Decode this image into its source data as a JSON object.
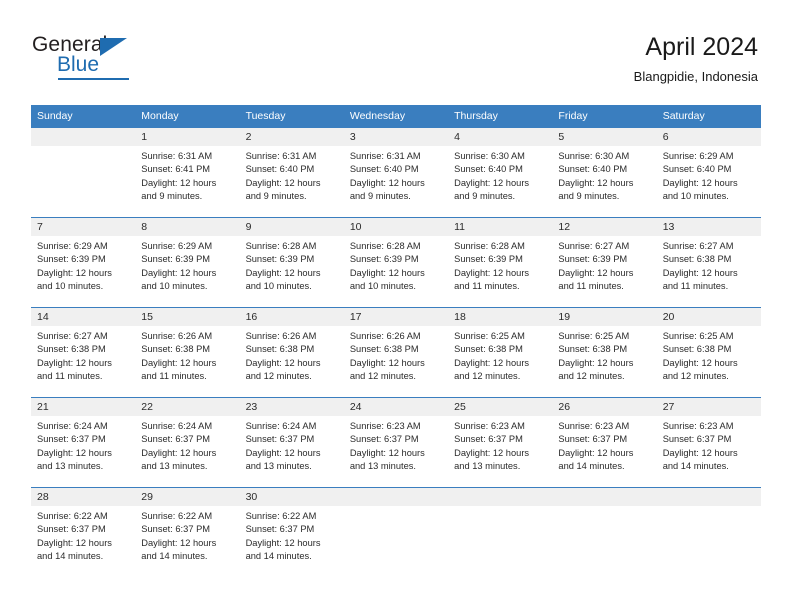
{
  "brand": {
    "name_top": "General",
    "name_bottom": "Blue",
    "triangle_color": "#1f6cb0",
    "accent_color": "#3a7ebf"
  },
  "header": {
    "title": "April 2024",
    "subtitle": "Blangpidie, Indonesia"
  },
  "weekdays": [
    "Sunday",
    "Monday",
    "Tuesday",
    "Wednesday",
    "Thursday",
    "Friday",
    "Saturday"
  ],
  "weeks": [
    [
      {
        "day": ""
      },
      {
        "day": "1",
        "sunrise": "Sunrise: 6:31 AM",
        "sunset": "Sunset: 6:41 PM",
        "daylight_line1": "Daylight: 12 hours",
        "daylight_line2": "and 9 minutes."
      },
      {
        "day": "2",
        "sunrise": "Sunrise: 6:31 AM",
        "sunset": "Sunset: 6:40 PM",
        "daylight_line1": "Daylight: 12 hours",
        "daylight_line2": "and 9 minutes."
      },
      {
        "day": "3",
        "sunrise": "Sunrise: 6:31 AM",
        "sunset": "Sunset: 6:40 PM",
        "daylight_line1": "Daylight: 12 hours",
        "daylight_line2": "and 9 minutes."
      },
      {
        "day": "4",
        "sunrise": "Sunrise: 6:30 AM",
        "sunset": "Sunset: 6:40 PM",
        "daylight_line1": "Daylight: 12 hours",
        "daylight_line2": "and 9 minutes."
      },
      {
        "day": "5",
        "sunrise": "Sunrise: 6:30 AM",
        "sunset": "Sunset: 6:40 PM",
        "daylight_line1": "Daylight: 12 hours",
        "daylight_line2": "and 9 minutes."
      },
      {
        "day": "6",
        "sunrise": "Sunrise: 6:29 AM",
        "sunset": "Sunset: 6:40 PM",
        "daylight_line1": "Daylight: 12 hours",
        "daylight_line2": "and 10 minutes."
      }
    ],
    [
      {
        "day": "7",
        "sunrise": "Sunrise: 6:29 AM",
        "sunset": "Sunset: 6:39 PM",
        "daylight_line1": "Daylight: 12 hours",
        "daylight_line2": "and 10 minutes."
      },
      {
        "day": "8",
        "sunrise": "Sunrise: 6:29 AM",
        "sunset": "Sunset: 6:39 PM",
        "daylight_line1": "Daylight: 12 hours",
        "daylight_line2": "and 10 minutes."
      },
      {
        "day": "9",
        "sunrise": "Sunrise: 6:28 AM",
        "sunset": "Sunset: 6:39 PM",
        "daylight_line1": "Daylight: 12 hours",
        "daylight_line2": "and 10 minutes."
      },
      {
        "day": "10",
        "sunrise": "Sunrise: 6:28 AM",
        "sunset": "Sunset: 6:39 PM",
        "daylight_line1": "Daylight: 12 hours",
        "daylight_line2": "and 10 minutes."
      },
      {
        "day": "11",
        "sunrise": "Sunrise: 6:28 AM",
        "sunset": "Sunset: 6:39 PM",
        "daylight_line1": "Daylight: 12 hours",
        "daylight_line2": "and 11 minutes."
      },
      {
        "day": "12",
        "sunrise": "Sunrise: 6:27 AM",
        "sunset": "Sunset: 6:39 PM",
        "daylight_line1": "Daylight: 12 hours",
        "daylight_line2": "and 11 minutes."
      },
      {
        "day": "13",
        "sunrise": "Sunrise: 6:27 AM",
        "sunset": "Sunset: 6:38 PM",
        "daylight_line1": "Daylight: 12 hours",
        "daylight_line2": "and 11 minutes."
      }
    ],
    [
      {
        "day": "14",
        "sunrise": "Sunrise: 6:27 AM",
        "sunset": "Sunset: 6:38 PM",
        "daylight_line1": "Daylight: 12 hours",
        "daylight_line2": "and 11 minutes."
      },
      {
        "day": "15",
        "sunrise": "Sunrise: 6:26 AM",
        "sunset": "Sunset: 6:38 PM",
        "daylight_line1": "Daylight: 12 hours",
        "daylight_line2": "and 11 minutes."
      },
      {
        "day": "16",
        "sunrise": "Sunrise: 6:26 AM",
        "sunset": "Sunset: 6:38 PM",
        "daylight_line1": "Daylight: 12 hours",
        "daylight_line2": "and 12 minutes."
      },
      {
        "day": "17",
        "sunrise": "Sunrise: 6:26 AM",
        "sunset": "Sunset: 6:38 PM",
        "daylight_line1": "Daylight: 12 hours",
        "daylight_line2": "and 12 minutes."
      },
      {
        "day": "18",
        "sunrise": "Sunrise: 6:25 AM",
        "sunset": "Sunset: 6:38 PM",
        "daylight_line1": "Daylight: 12 hours",
        "daylight_line2": "and 12 minutes."
      },
      {
        "day": "19",
        "sunrise": "Sunrise: 6:25 AM",
        "sunset": "Sunset: 6:38 PM",
        "daylight_line1": "Daylight: 12 hours",
        "daylight_line2": "and 12 minutes."
      },
      {
        "day": "20",
        "sunrise": "Sunrise: 6:25 AM",
        "sunset": "Sunset: 6:38 PM",
        "daylight_line1": "Daylight: 12 hours",
        "daylight_line2": "and 12 minutes."
      }
    ],
    [
      {
        "day": "21",
        "sunrise": "Sunrise: 6:24 AM",
        "sunset": "Sunset: 6:37 PM",
        "daylight_line1": "Daylight: 12 hours",
        "daylight_line2": "and 13 minutes."
      },
      {
        "day": "22",
        "sunrise": "Sunrise: 6:24 AM",
        "sunset": "Sunset: 6:37 PM",
        "daylight_line1": "Daylight: 12 hours",
        "daylight_line2": "and 13 minutes."
      },
      {
        "day": "23",
        "sunrise": "Sunrise: 6:24 AM",
        "sunset": "Sunset: 6:37 PM",
        "daylight_line1": "Daylight: 12 hours",
        "daylight_line2": "and 13 minutes."
      },
      {
        "day": "24",
        "sunrise": "Sunrise: 6:23 AM",
        "sunset": "Sunset: 6:37 PM",
        "daylight_line1": "Daylight: 12 hours",
        "daylight_line2": "and 13 minutes."
      },
      {
        "day": "25",
        "sunrise": "Sunrise: 6:23 AM",
        "sunset": "Sunset: 6:37 PM",
        "daylight_line1": "Daylight: 12 hours",
        "daylight_line2": "and 13 minutes."
      },
      {
        "day": "26",
        "sunrise": "Sunrise: 6:23 AM",
        "sunset": "Sunset: 6:37 PM",
        "daylight_line1": "Daylight: 12 hours",
        "daylight_line2": "and 14 minutes."
      },
      {
        "day": "27",
        "sunrise": "Sunrise: 6:23 AM",
        "sunset": "Sunset: 6:37 PM",
        "daylight_line1": "Daylight: 12 hours",
        "daylight_line2": "and 14 minutes."
      }
    ],
    [
      {
        "day": "28",
        "sunrise": "Sunrise: 6:22 AM",
        "sunset": "Sunset: 6:37 PM",
        "daylight_line1": "Daylight: 12 hours",
        "daylight_line2": "and 14 minutes."
      },
      {
        "day": "29",
        "sunrise": "Sunrise: 6:22 AM",
        "sunset": "Sunset: 6:37 PM",
        "daylight_line1": "Daylight: 12 hours",
        "daylight_line2": "and 14 minutes."
      },
      {
        "day": "30",
        "sunrise": "Sunrise: 6:22 AM",
        "sunset": "Sunset: 6:37 PM",
        "daylight_line1": "Daylight: 12 hours",
        "daylight_line2": "and 14 minutes."
      },
      {
        "day": ""
      },
      {
        "day": ""
      },
      {
        "day": ""
      },
      {
        "day": ""
      }
    ]
  ]
}
